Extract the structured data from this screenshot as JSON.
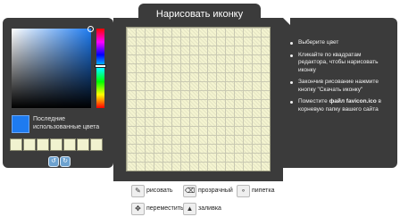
{
  "title": "Нарисовать иконку",
  "color_picker": {
    "current_color": "#1e7bf0",
    "recent_label": "Последние использованные цвета",
    "recent_colors": [
      "#f1f2cf",
      "#f1f2cf",
      "#f1f2cf",
      "#f1f2cf",
      "#f1f2cf",
      "#f1f2cf",
      "#f1f2cf",
      "#f1f2cf"
    ]
  },
  "instructions": {
    "item1": "Выберите цвет",
    "item2": "Кликайте по квадратам редактора, чтобы нарисовать иконку",
    "item3": "Закончив рисование нажмите кнопку \"Скачать иконку\"",
    "item4_prefix": "Поместите ",
    "item4_bold": "файл favicon.ico",
    "item4_suffix": " в корневую папку вашего сайта"
  },
  "tools": {
    "draw": "рисовать",
    "transparent": "прозрачный",
    "eyedropper": "пипетка",
    "move": "переместить",
    "fill": "заливка"
  },
  "icons": {
    "draw": "pencil-icon",
    "transparent": "eraser-icon",
    "eyedropper": "eyedropper-icon",
    "move": "move-icon",
    "fill": "fill-bucket-icon",
    "undo": "undo-icon",
    "redo": "redo-icon"
  }
}
